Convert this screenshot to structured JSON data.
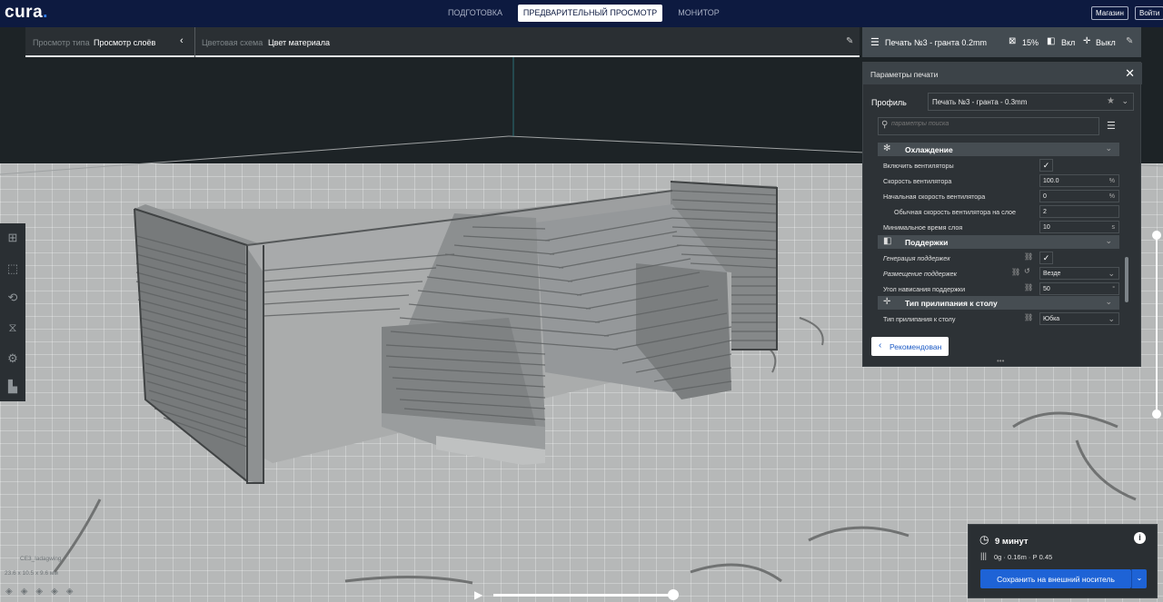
{
  "app": {
    "logo": "cura",
    "logo_dot": "."
  },
  "stages": [
    {
      "label": "ПОДГОТОВКА"
    },
    {
      "label": "ПРЕДВАРИТЕЛЬНЫЙ ПРОСМОТР"
    },
    {
      "label": "МОНИТОР"
    }
  ],
  "topbar": {
    "marketplace": "Магазин",
    "signin": "Войти"
  },
  "viewbar": {
    "view_type_label": "Просмотр типа",
    "view_type_value": "Просмотр слоёв",
    "color_scheme_label": "Цветовая схема",
    "color_scheme_value": "Цвет материала"
  },
  "print_header": {
    "profile": "Печать №3 - гранта 0.2mm",
    "infill": "15%",
    "support": "Вкл",
    "adhesion": "Выкл"
  },
  "settings": {
    "title": "Параметры печати",
    "profile_label": "Профиль",
    "profile_value": "Печать №3 - гранта - 0.3mm",
    "search_placeholder": "параметры поиска",
    "categories": [
      {
        "label": "Охлаждение"
      },
      {
        "label": "Поддержки"
      },
      {
        "label": "Тип прилипания к столу"
      }
    ],
    "cooling": {
      "fan_enable": "Включить вентиляторы",
      "fan_speed": "Скорость вентилятора",
      "fan_speed_value": "100.0",
      "fan_speed_unit": "%",
      "initial_fan_speed": "Начальная скорость вентилятора",
      "initial_fan_speed_value": "0",
      "initial_fan_speed_unit": "%",
      "regular_fan_layer": "Обычная скорость вентилятора на слое",
      "regular_fan_layer_value": "2",
      "min_layer_time": "Минимальное время слоя",
      "min_layer_time_value": "10",
      "min_layer_time_unit": "s"
    },
    "support": {
      "generate": "Генерация поддержек",
      "placement": "Размещение поддержек",
      "placement_value": "Везде",
      "angle": "Угол нависания поддержки",
      "angle_value": "50",
      "angle_unit": "°"
    },
    "adhesion": {
      "type": "Тип прилипания к столу",
      "type_value": "Юбка"
    },
    "recommended": "Рекомендован"
  },
  "object": {
    "name": "CE3_ladagwing",
    "dims": "23.6 x 10.5 x 9.6 мм"
  },
  "output": {
    "time": "9 минут",
    "material": "0g · 0.16m · Р 0.45",
    "save": "Сохранить на внешний носитель"
  },
  "colors": {
    "topbar": "#0d1a40",
    "accent": "#1e63d6",
    "panel": "#2d3236"
  },
  "icons": [
    "star-icon",
    "chevron-down-icon",
    "search-icon",
    "menu-icon",
    "close-icon",
    "link-icon",
    "reset-icon",
    "check-icon",
    "clock-icon",
    "info-icon",
    "play-icon",
    "pencil-icon"
  ]
}
